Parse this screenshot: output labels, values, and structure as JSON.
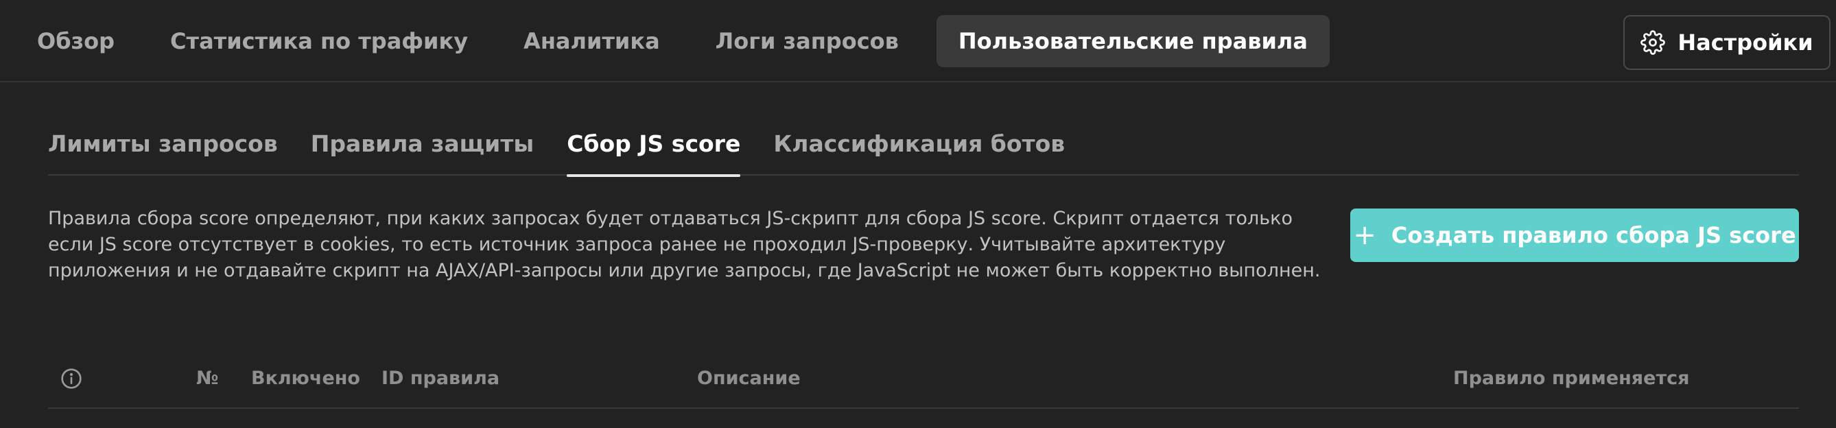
{
  "topnav": {
    "items": [
      {
        "label": "Обзор"
      },
      {
        "label": "Статистика по трафику"
      },
      {
        "label": "Аналитика"
      },
      {
        "label": "Логи запросов"
      },
      {
        "label": "Пользовательские правила",
        "active": true
      }
    ],
    "settings_label": "Настройки",
    "settings_icon": "gear-icon"
  },
  "subtabs": [
    {
      "label": "Лимиты запросов"
    },
    {
      "label": "Правила защиты"
    },
    {
      "label": "Сбор JS score",
      "active": true
    },
    {
      "label": "Классификация ботов"
    }
  ],
  "description": {
    "line1": "Правила сбора score определяют, при каких запросах будет отдаваться JS-скрипт для сбора JS score. Скрипт отдается только",
    "line2": "если JS score отсутствует в cookies, то есть источник запроса ранее не проходил JS-проверку. Учитывайте архитектуру",
    "line3": "приложения и не отдавайте скрипт на AJAX/API-запросы или другие запросы, где JavaScript не может быть корректно выполнен."
  },
  "create_button": {
    "icon": "plus-icon",
    "plus": "+",
    "label": "Создать правило сбора JS score"
  },
  "table": {
    "info_icon": "info-icon",
    "columns": [
      "№",
      "Включено",
      "ID правила",
      "Описание",
      "Правило применяется"
    ]
  },
  "colors": {
    "background": "#222222",
    "accent": "#5fd0cb",
    "active_tab_bg": "#3a3a3a"
  }
}
